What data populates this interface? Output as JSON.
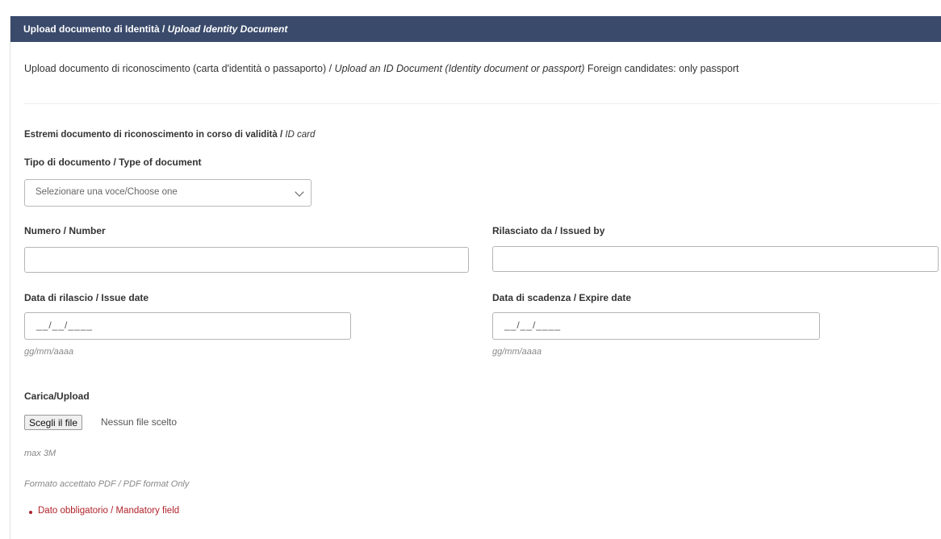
{
  "header": {
    "title_it": "Upload documento di Identità / ",
    "title_en": "Upload Identity Document"
  },
  "intro": {
    "text_it": "Upload documento di riconoscimento (carta d'identità o passaporto) / ",
    "text_en": "Upload an ID Document (Identity document or passport)",
    "text_note": " Foreign candidates: only passport"
  },
  "section": {
    "title_it": "Estremi documento di riconoscimento in corso di validità / ",
    "title_en": "ID card"
  },
  "doc_type": {
    "label": "Tipo di documento / Type of document",
    "selected": "Selezionare una voce/Choose one"
  },
  "number": {
    "label": "Numero / Number",
    "value": ""
  },
  "issued_by": {
    "label": "Rilasciato da / Issued by",
    "value": ""
  },
  "issue_date": {
    "label": "Data di rilascio / Issue date",
    "value": "__/__/____",
    "hint": "gg/mm/aaaa"
  },
  "expire_date": {
    "label": "Data di scadenza / Expire date",
    "value": "__/__/____",
    "hint": "gg/mm/aaaa"
  },
  "upload": {
    "label": "Carica/Upload",
    "button": "Scegli il file",
    "status": "Nessun file scelto",
    "max_size": "max 3M",
    "format": "Formato accettato PDF / PDF format Only"
  },
  "errors": [
    "Dato obbligatorio / Mandatory field"
  ],
  "colors": {
    "header_bg": "#3a4a6b",
    "error": "#b0232a"
  }
}
